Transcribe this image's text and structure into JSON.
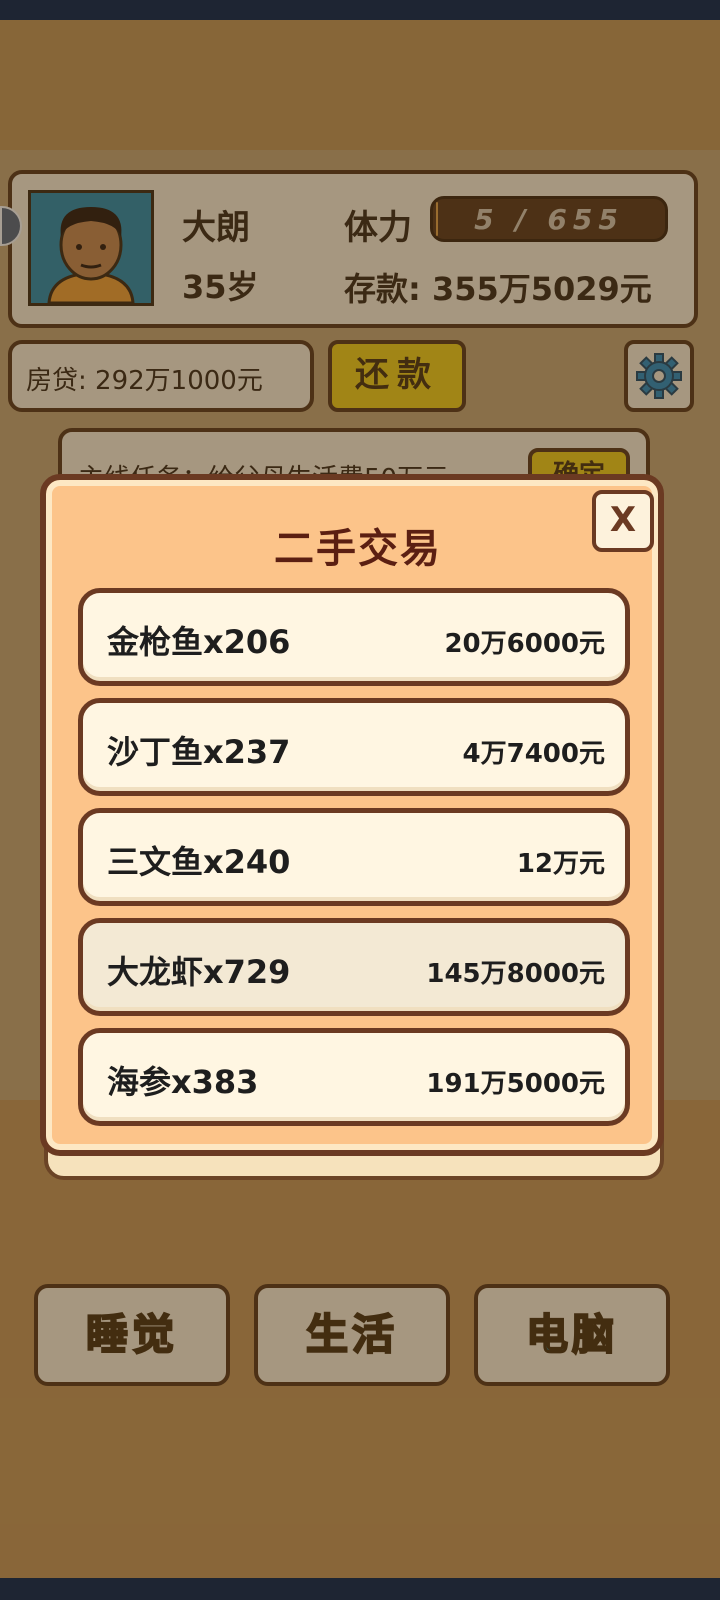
{
  "player": {
    "name": "大朗",
    "age": "35岁",
    "stamina_label": "体力",
    "stamina_value": "5 / 655",
    "stamina_fraction": 0.008,
    "savings": "存款: 355万5029元"
  },
  "mortgage": "房贷: 292万1000元",
  "repay_label": "还款",
  "task_partial": "主线任务：给父母生活费50万元",
  "task_button": "确定",
  "modal": {
    "title": "二手交易",
    "close_label": "X",
    "items": [
      {
        "name": "金枪鱼x206",
        "price": "20万6000元"
      },
      {
        "name": "沙丁鱼x237",
        "price": "4万7400元"
      },
      {
        "name": "三文鱼x240",
        "price": "12万元"
      },
      {
        "name": "大龙虾x729",
        "price": "145万8000元"
      },
      {
        "name": "海参x383",
        "price": "191万5000元"
      }
    ]
  },
  "bottom_buttons": [
    {
      "label": "睡觉",
      "color": "#f2c31a"
    },
    {
      "label": "生活",
      "color": "#3fae3a"
    },
    {
      "label": "电脑",
      "color": "#2fa6c6"
    }
  ],
  "colors": {
    "accent": "#f4d21c",
    "border": "#5b3a1c",
    "modal": "#fcc48a"
  },
  "icons": [
    "settings-gear-icon",
    "side-tab-icon"
  ]
}
